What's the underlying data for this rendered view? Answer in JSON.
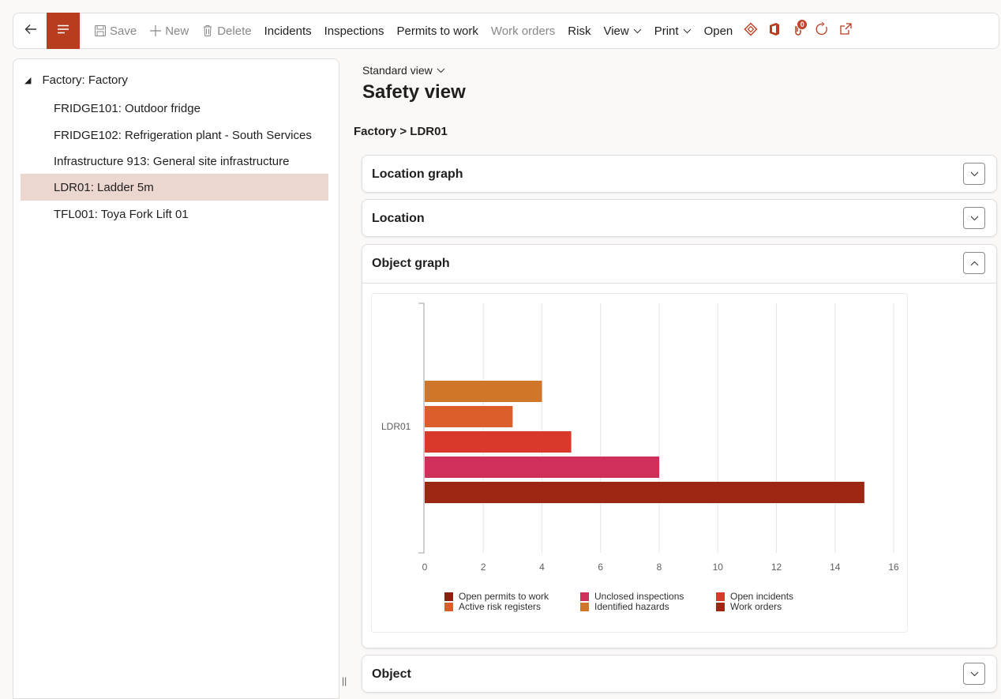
{
  "toolbar": {
    "save": "Save",
    "new": "New",
    "delete": "Delete",
    "incidents": "Incidents",
    "inspections": "Inspections",
    "permits": "Permits to work",
    "work_orders": "Work orders",
    "risk": "Risk",
    "view": "View",
    "print": "Print",
    "open": "Open",
    "notification_count": "0",
    "accent": "#b83c1e"
  },
  "tree": {
    "root": "Factory: Factory",
    "items": [
      "FRIDGE101: Outdoor fridge",
      "FRIDGE102: Refrigeration plant - South Services",
      "Infrastructure 913: General site infrastructure",
      "LDR01: Ladder 5m",
      "TFL001: Toya Fork Lift 01"
    ],
    "selected_index": 3
  },
  "view_selector": "Standard view",
  "page_title": "Safety view",
  "breadcrumb": "Factory > LDR01",
  "sections": {
    "location_graph": "Location graph",
    "location": "Location",
    "object_graph": "Object graph",
    "object": "Object"
  },
  "chart_data": {
    "type": "bar",
    "orientation": "horizontal",
    "categories": [
      "LDR01"
    ],
    "series": [
      {
        "name": "Identified hazards",
        "values": [
          4
        ],
        "color": "#cf762b"
      },
      {
        "name": "Active risk registers",
        "values": [
          3
        ],
        "color": "#db5e2a"
      },
      {
        "name": "Open incidents",
        "values": [
          5
        ],
        "color": "#d9392b"
      },
      {
        "name": "Unclosed inspections",
        "values": [
          8
        ],
        "color": "#d02f59"
      },
      {
        "name": "Work orders",
        "values": [
          15
        ],
        "color": "#9c2712"
      }
    ],
    "xlim": [
      0,
      16
    ],
    "xticks": [
      0,
      2,
      4,
      6,
      8,
      10,
      12,
      14,
      16
    ],
    "grid": true,
    "legend": [
      {
        "name": "Open permits to work",
        "color": "#8d1f10"
      },
      {
        "name": "Unclosed inspections",
        "color": "#d02f59"
      },
      {
        "name": "Open incidents",
        "color": "#d9392b"
      },
      {
        "name": "Active risk registers",
        "color": "#db5e2a"
      },
      {
        "name": "Identified hazards",
        "color": "#cf762b"
      },
      {
        "name": "Work orders",
        "color": "#9c2712"
      }
    ],
    "legend_position": "bottom"
  }
}
